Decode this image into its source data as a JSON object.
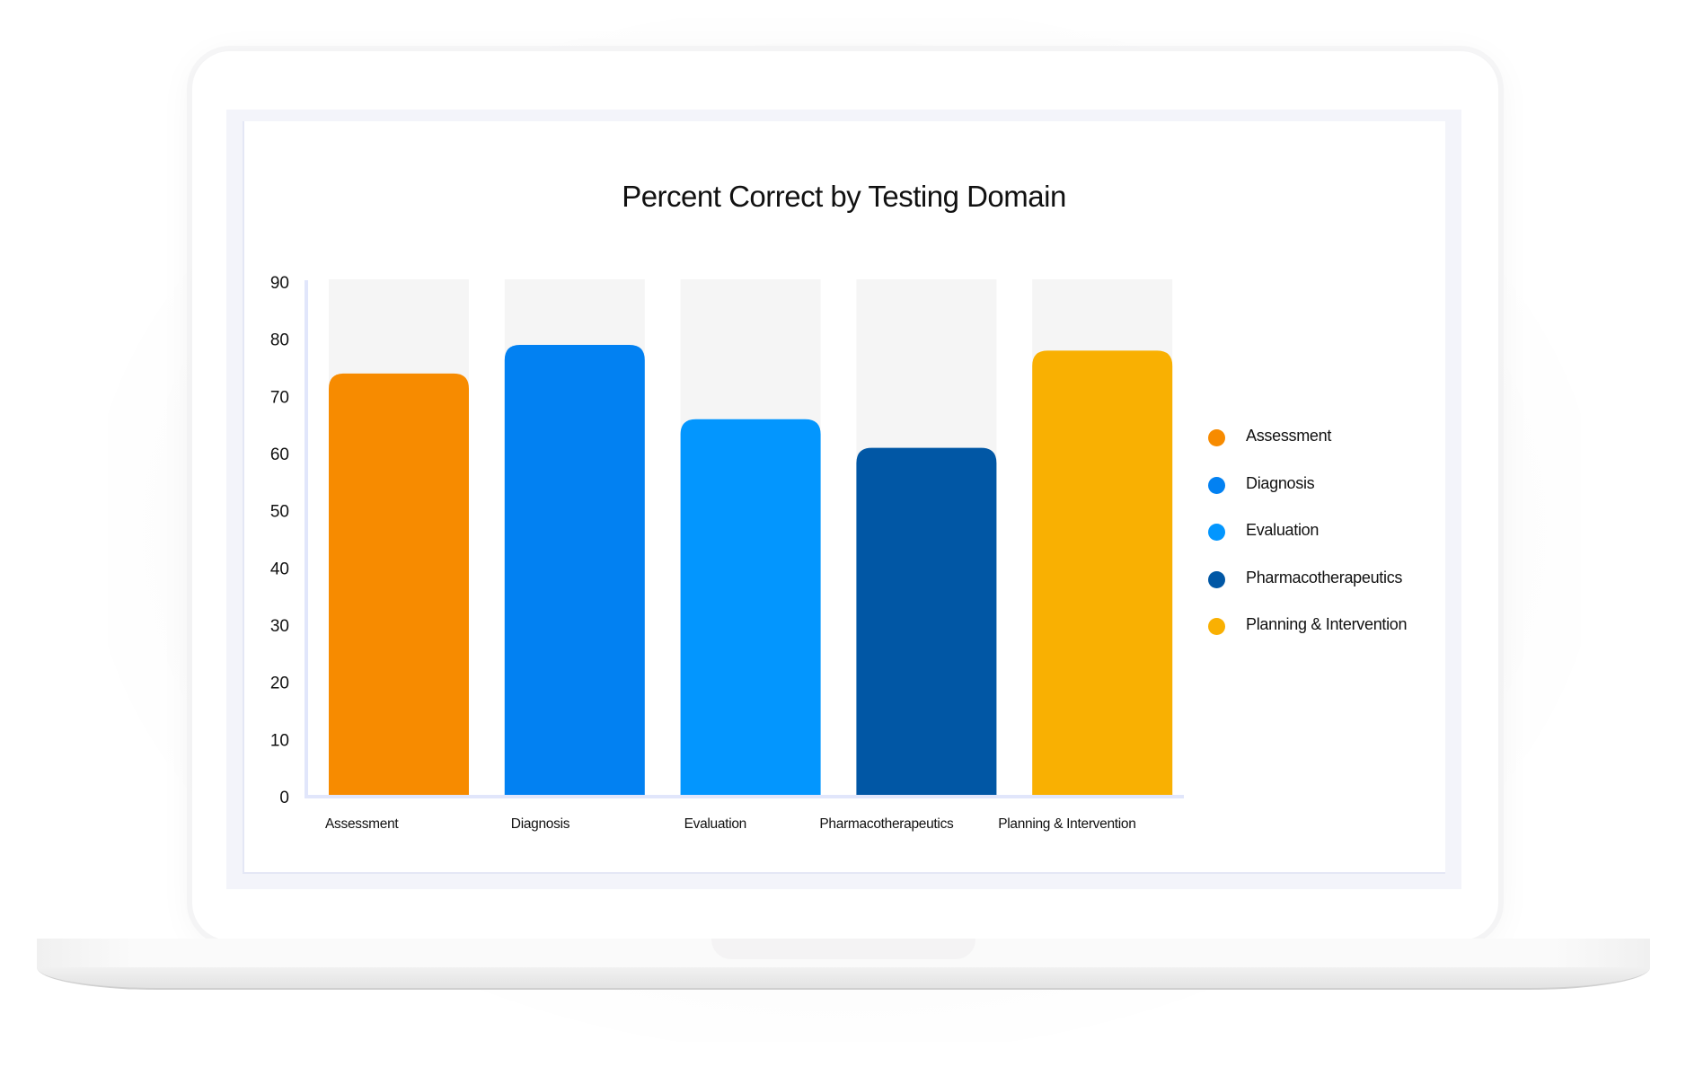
{
  "chart_data": {
    "type": "bar",
    "title": "Percent Correct by Testing Domain",
    "xlabel": "",
    "ylabel": "",
    "ylim": [
      0,
      90
    ],
    "yticks": [
      "0",
      "10",
      "20",
      "30",
      "40",
      "50",
      "60",
      "70",
      "80",
      "90"
    ],
    "grid": false,
    "background_bar_max": 90,
    "legend_position": "right",
    "categories": [
      "Assessment",
      "Diagnosis",
      "Evaluation",
      "Pharmacotherapeutics",
      "Planning & Intervention"
    ],
    "values": [
      74,
      79,
      66,
      61,
      78
    ],
    "colors": [
      "#f78b00",
      "#0281f2",
      "#0396fe",
      "#0157a5",
      "#f9b002"
    ],
    "legend": [
      {
        "label": "Assessment",
        "color": "#f78b00"
      },
      {
        "label": "Diagnosis",
        "color": "#0281f2"
      },
      {
        "label": "Evaluation",
        "color": "#0396fe"
      },
      {
        "label": "Pharmacotherapeutics",
        "color": "#0157a5"
      },
      {
        "label": "Planning & Intervention",
        "color": "#f9b002"
      }
    ]
  },
  "colors": {
    "axis": "#e1e6fb",
    "track": "#f5f5f5",
    "text": "#111111"
  }
}
